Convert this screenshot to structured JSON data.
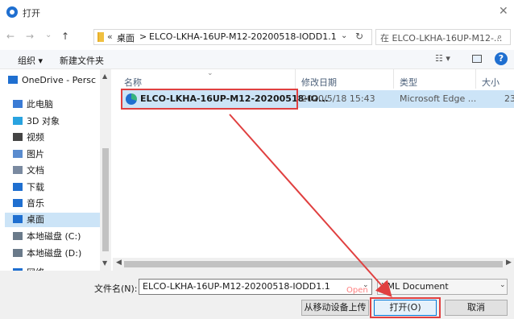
{
  "window": {
    "title": "打开",
    "close": "✕"
  },
  "nav": {
    "back": "←",
    "forward": "→",
    "recent": "⌄",
    "up": "↑"
  },
  "address": {
    "prefix": "«",
    "crumbs": [
      "桌面",
      ">",
      "ELCO-LKHA-16UP-M12-20200518-IODD1.1"
    ],
    "dropdown": "⌄",
    "refresh": "↻"
  },
  "search": {
    "placeholder": "在 ELCO-LKHA-16UP-M12-...",
    "icon": "⌕"
  },
  "toolbar": {
    "organize": "组织 ▾",
    "new_folder": "新建文件夹",
    "view": "☷ ▾",
    "help": "?"
  },
  "sidebar": {
    "items": [
      {
        "label": "OneDrive - Persc",
        "icon": "cloud-icon",
        "color": "#1f6fd0"
      },
      {
        "label": "此电脑",
        "icon": "computer-icon",
        "color": "#3a7bd5"
      },
      {
        "label": "3D 对象",
        "icon": "cube-icon",
        "color": "#29a3e0"
      },
      {
        "label": "视频",
        "icon": "video-icon",
        "color": "#444444"
      },
      {
        "label": "图片",
        "icon": "picture-icon",
        "color": "#5a8ccf"
      },
      {
        "label": "文档",
        "icon": "document-icon",
        "color": "#7a8aa0"
      },
      {
        "label": "下载",
        "icon": "download-icon",
        "color": "#1f6fd0"
      },
      {
        "label": "音乐",
        "icon": "music-icon",
        "color": "#1f6fd0"
      },
      {
        "label": "桌面",
        "icon": "desktop-icon",
        "color": "#1f6fd0"
      },
      {
        "label": "本地磁盘 (C:)",
        "icon": "drive-icon",
        "color": "#6a7a8a"
      },
      {
        "label": "本地磁盘 (D:)",
        "icon": "drive-icon",
        "color": "#6a7a8a"
      },
      {
        "label": "网络",
        "icon": "network-icon",
        "color": "#1f6fd0"
      }
    ],
    "selected_index": 8
  },
  "columns": {
    "name": "名称",
    "modified": "修改日期",
    "type": "类型",
    "size": "大小",
    "sort_indicator": "⌄"
  },
  "files": [
    {
      "name": "ELCO-LKHA-16UP-M12-20200518-IO...",
      "modified": "2020/5/18 15:43",
      "type": "Microsoft Edge ...",
      "size": "23"
    }
  ],
  "bottom": {
    "filename_label": "文件名(N):",
    "filename_value": "ELCO-LKHA-16UP-M12-20200518-IODD1.1",
    "filetype_value": "XML Document",
    "mobile_upload": "从移动设备上传",
    "open": "打开(O)",
    "cancel": "取消",
    "open_ghost": "Open"
  },
  "annotation_color": "#e04040"
}
